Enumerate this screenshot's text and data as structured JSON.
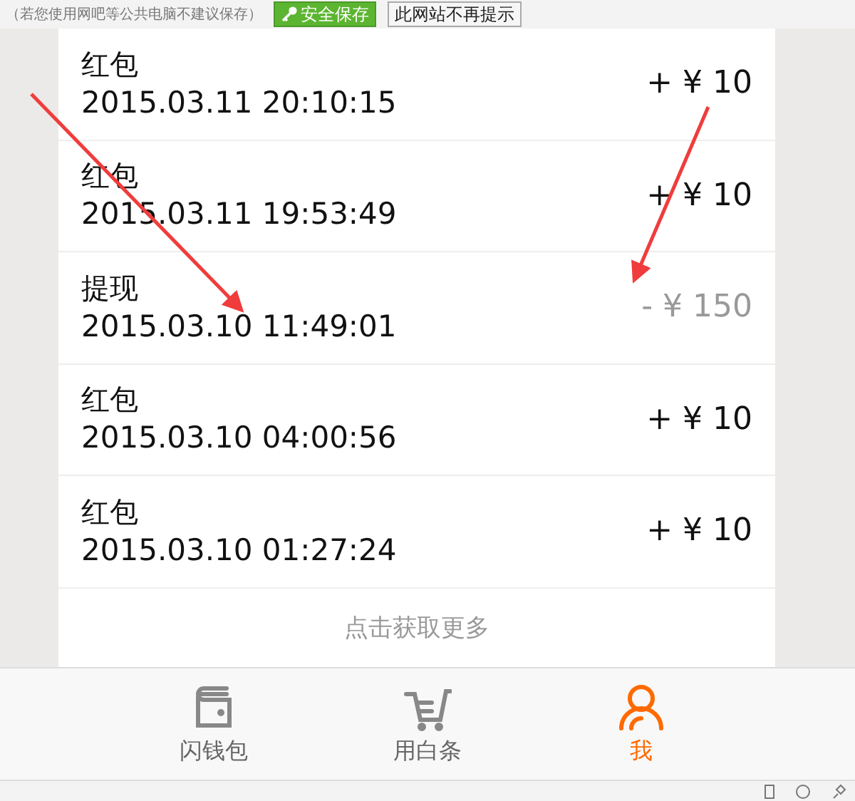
{
  "save_prompt": {
    "note": "（若您使用网吧等公共电脑不建议保存）",
    "buttons": [
      {
        "label": "安全保存",
        "kind": "primary"
      },
      {
        "label": "此网站不再提示",
        "kind": "plain"
      }
    ]
  },
  "transactions": [
    {
      "title": "红包",
      "time": "2015.03.11 20:10:15",
      "amount": "+ ¥ 10",
      "kind": "income"
    },
    {
      "title": "红包",
      "time": "2015.03.11 19:53:49",
      "amount": "+ ¥ 10",
      "kind": "income"
    },
    {
      "title": "提现",
      "time": "2015.03.10 11:49:01",
      "amount": "- ¥ 150",
      "kind": "withdrawal"
    },
    {
      "title": "红包",
      "time": "2015.03.10 04:00:56",
      "amount": "+ ¥ 10",
      "kind": "income"
    },
    {
      "title": "红包",
      "time": "2015.03.10 01:27:24",
      "amount": "+ ¥ 10",
      "kind": "income"
    }
  ],
  "load_more": "点击获取更多",
  "nav": [
    {
      "label": "闪钱包",
      "selected": false
    },
    {
      "label": "用白条",
      "selected": false
    },
    {
      "label": "我",
      "selected": true
    }
  ]
}
